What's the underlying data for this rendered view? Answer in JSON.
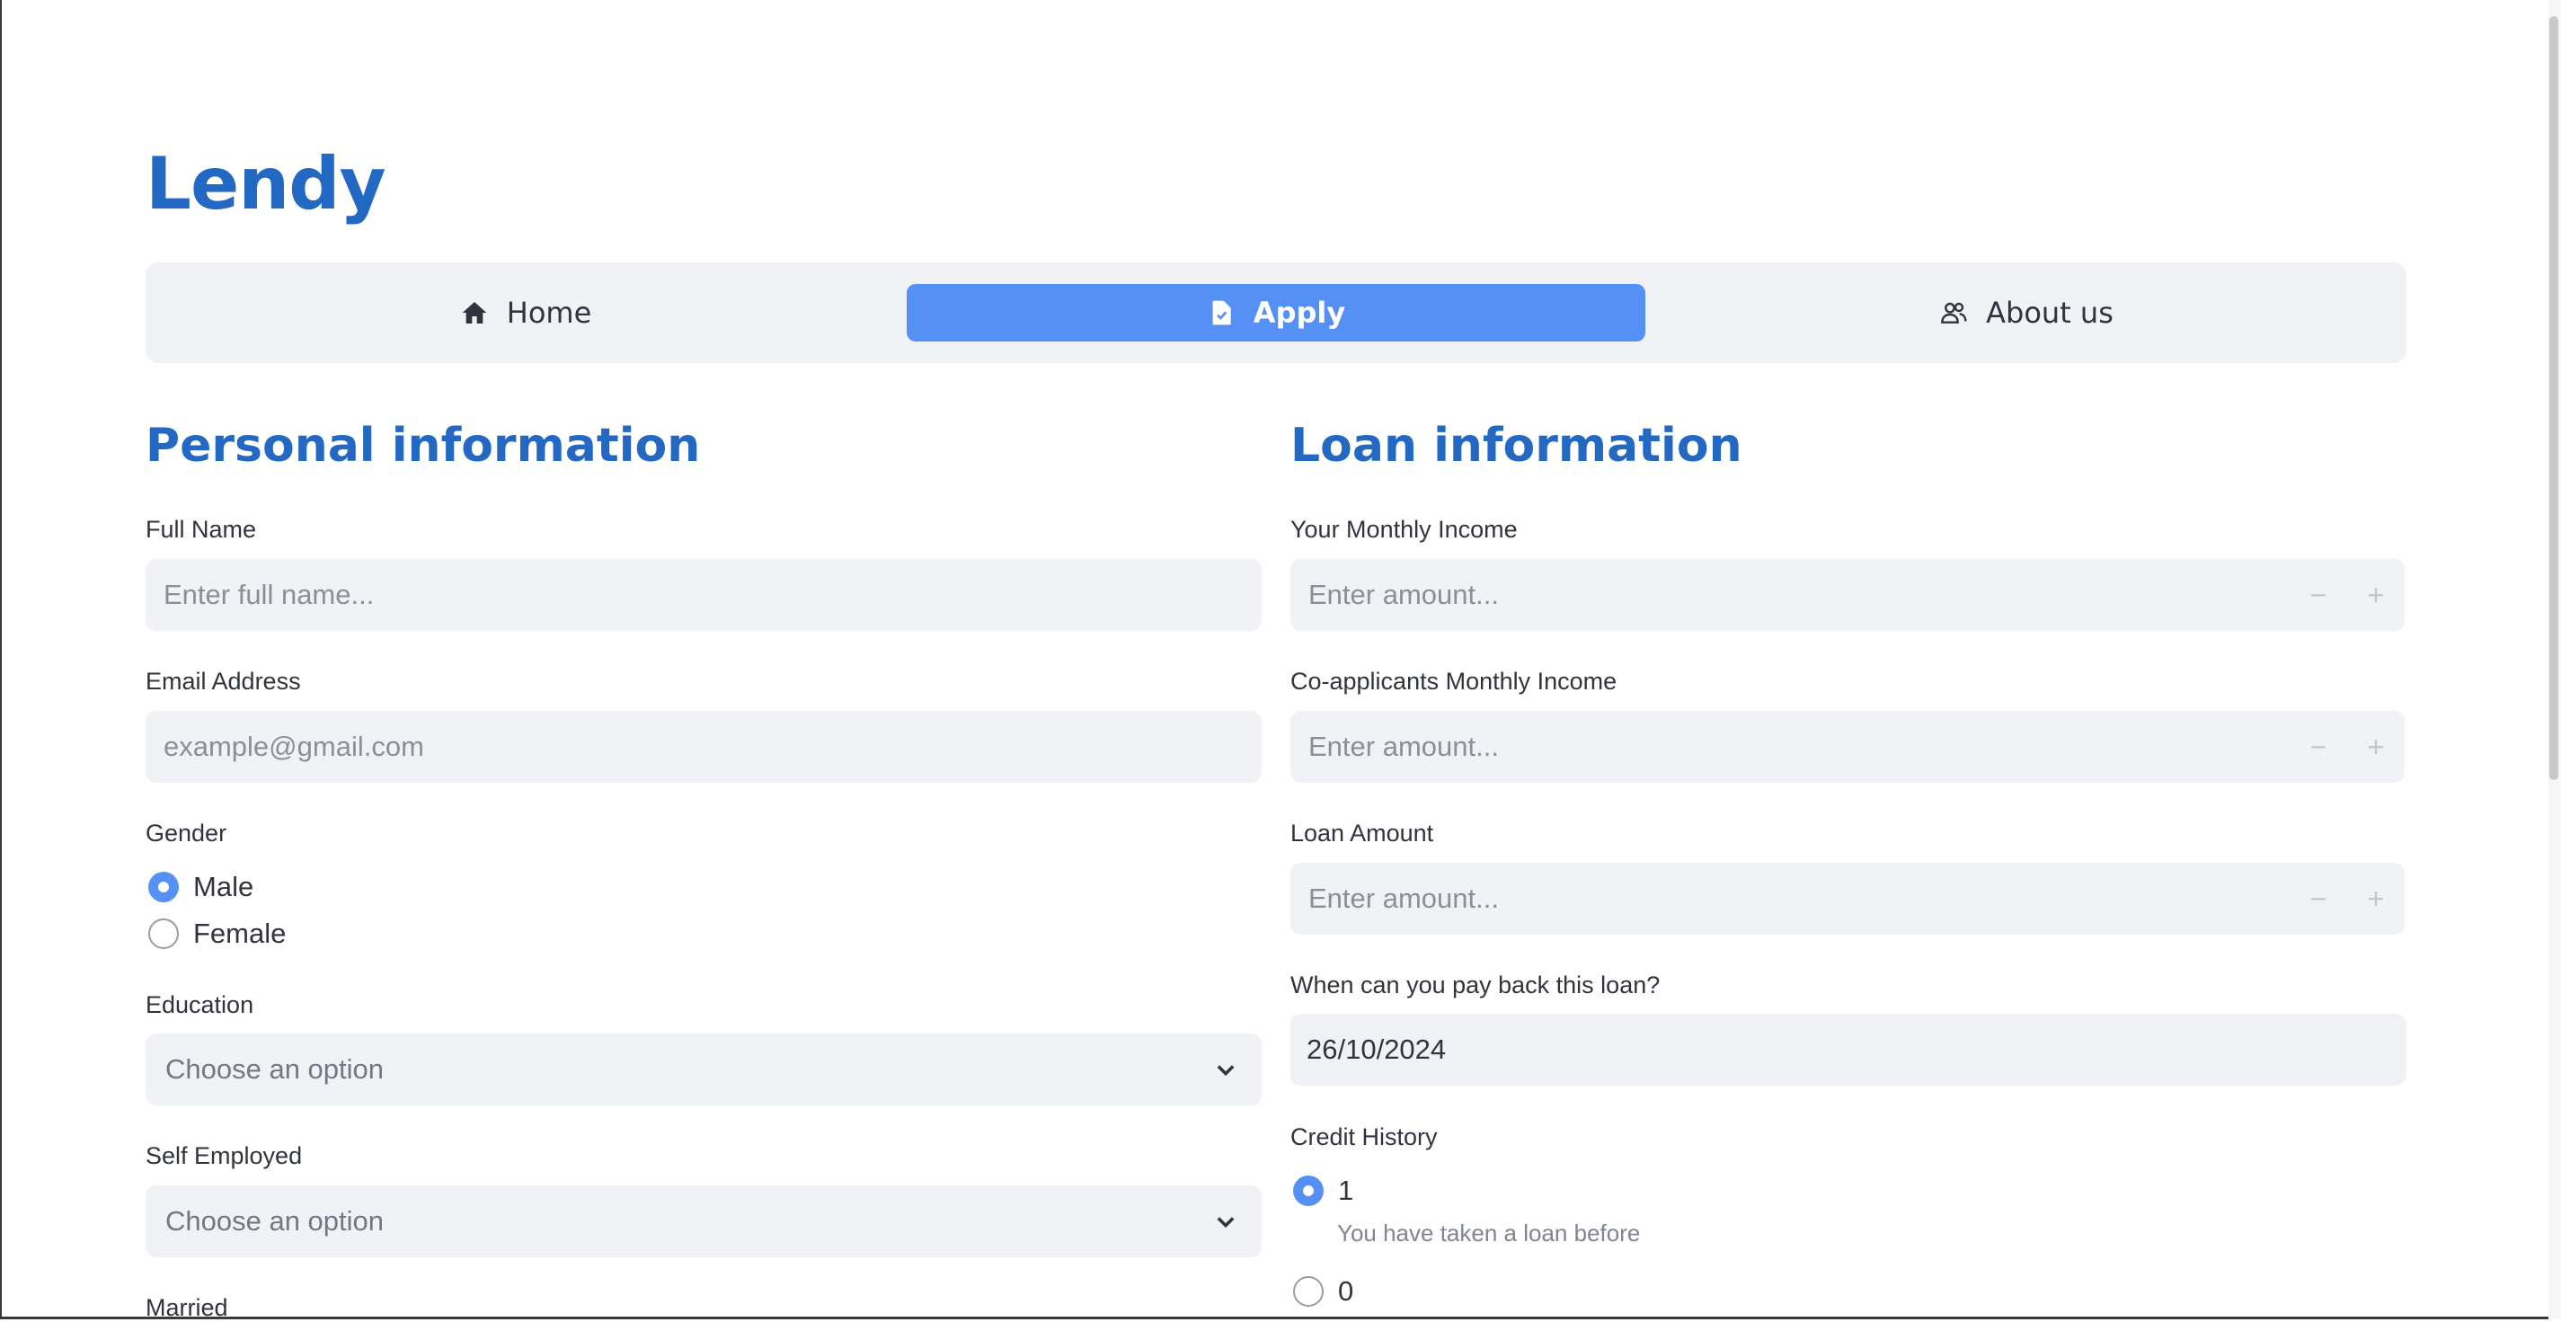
{
  "app": {
    "title": "Lendy"
  },
  "nav": {
    "items": [
      {
        "label": "Home",
        "icon": "house-icon",
        "active": false
      },
      {
        "label": "Apply",
        "icon": "file-check-icon",
        "active": true
      },
      {
        "label": "About us",
        "icon": "people-icon",
        "active": false
      }
    ]
  },
  "personal": {
    "title": "Personal information",
    "full_name": {
      "label": "Full Name",
      "placeholder": "Enter full name..."
    },
    "email": {
      "label": "Email Address",
      "placeholder": "example@gmail.com"
    },
    "gender": {
      "label": "Gender",
      "options": [
        "Male",
        "Female"
      ],
      "selected": "Male"
    },
    "education": {
      "label": "Education",
      "placeholder": "Choose an option"
    },
    "self_employed": {
      "label": "Self Employed",
      "placeholder": "Choose an option"
    },
    "married": {
      "label": "Married"
    }
  },
  "loan": {
    "title": "Loan information",
    "monthly_income": {
      "label": "Your Monthly Income",
      "placeholder": "Enter amount..."
    },
    "coapplicant_income": {
      "label": "Co-applicants Monthly Income",
      "placeholder": "Enter amount..."
    },
    "loan_amount": {
      "label": "Loan Amount",
      "placeholder": "Enter amount..."
    },
    "payback_date": {
      "label": "When can you pay back this loan?",
      "value": "26/10/2024"
    },
    "credit_history": {
      "label": "Credit History",
      "options": [
        {
          "value": "1",
          "help": "You have taken a loan before",
          "selected": true
        },
        {
          "value": "0",
          "selected": false
        }
      ]
    }
  },
  "stepper": {
    "minus": "−",
    "plus": "+"
  },
  "colors": {
    "accent": "#5591f5",
    "title": "#2369c4",
    "field_bg": "#f0f2f6"
  }
}
